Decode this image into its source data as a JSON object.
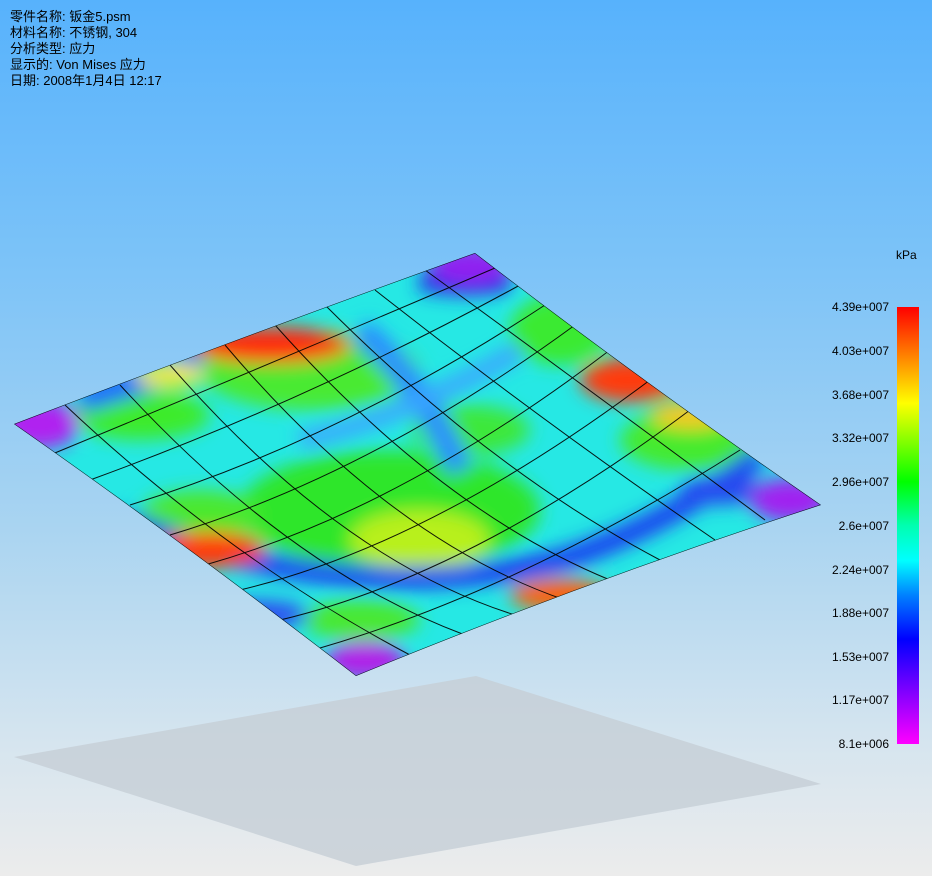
{
  "info": {
    "part_name": "零件名称: 钣金5.psm",
    "material": "材料名称: 不锈钢, 304",
    "analysis_type": "分析类型: 应力",
    "displayed": "显示的: Von Mises 应力",
    "date": "日期: 2008年1月4日  12:17"
  },
  "legend": {
    "unit": "kPa",
    "ticks": [
      "4.39e+007",
      "4.03e+007",
      "3.68e+007",
      "3.32e+007",
      "2.96e+007",
      "2.6e+007",
      "2.24e+007",
      "1.88e+007",
      "1.53e+007",
      "1.17e+007",
      "8.1e+006"
    ],
    "colors": {
      "max": "#ff0000",
      "mid": "#00ffff",
      "min": "#ff00ff"
    }
  },
  "background": {
    "top": "#57b2fc",
    "bottom": "#ececec"
  }
}
